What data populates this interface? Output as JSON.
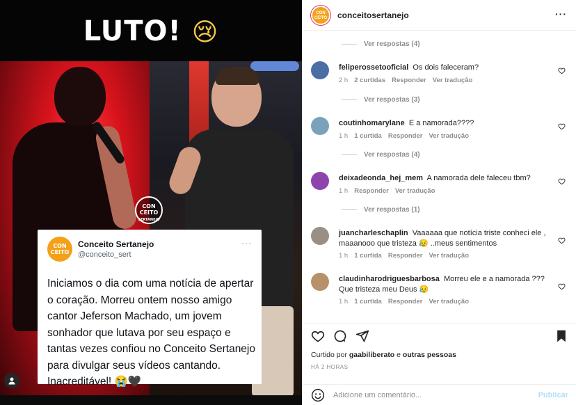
{
  "image": {
    "headline": "LUTO!",
    "headline_emoji": "😢",
    "watermark": "CON CEITO SERTANEJO",
    "tweet": {
      "avatar_text": "CON CEITO",
      "name": "Conceito Sertanejo",
      "handle": "@conceito_sert",
      "more": "···",
      "text": "Iniciamos o dia com uma notícia de apertar o coração. Morreu ontem nosso amigo cantor Jeferson Machado, um jovem sonhador que lutava por seu espaço e tantas vezes confiou no Conceito Sertanejo para divulgar seus vídeos cantando. Inacreditável! 😭🖤"
    }
  },
  "header": {
    "avatar_text": "CON CEITO",
    "username": "conceitosertanejo",
    "more": "···"
  },
  "comments": [
    {
      "type": "replies",
      "label": "Ver respostas (4)"
    },
    {
      "type": "comment",
      "username": "feliperossetooficial",
      "text": "Os dois faleceram?",
      "time": "2 h",
      "likes": "2 curtidas",
      "reply": "Responder",
      "translate": "Ver tradução",
      "avatar_color": "#4a6fa5"
    },
    {
      "type": "replies",
      "label": "Ver respostas (3)"
    },
    {
      "type": "comment",
      "username": "coutinhomarylane",
      "text": "E a namorada????",
      "time": "1 h",
      "likes": "1 curtida",
      "reply": "Responder",
      "translate": "Ver tradução",
      "avatar_color": "#7aa2b8"
    },
    {
      "type": "replies",
      "label": "Ver respostas (4)"
    },
    {
      "type": "comment",
      "username": "deixadeonda_hej_mem",
      "text": "A namorada dele faleceu tbm?",
      "time": "1 h",
      "likes": "",
      "reply": "Responder",
      "translate": "Ver tradução",
      "avatar_color": "#8e44ad"
    },
    {
      "type": "replies",
      "label": "Ver respostas (1)"
    },
    {
      "type": "comment",
      "username": "juancharleschaplin",
      "text": "Vaaaaaa que notícia triste conheci ele , maaanooo que tristeza 😥 ..meus sentimentos",
      "time": "1 h",
      "likes": "1 curtida",
      "reply": "Responder",
      "translate": "Ver tradução",
      "avatar_color": "#9a8f84"
    },
    {
      "type": "comment",
      "username": "claudinharodriguesbarbosa",
      "text": "Morreu ele e a namorada ??? Que tristeza meu Deus 😥",
      "time": "1 h",
      "likes": "1 curtida",
      "reply": "Responder",
      "translate": "Ver tradução",
      "avatar_color": "#b8906a"
    }
  ],
  "footer": {
    "liked_by_prefix": "Curtido por",
    "liked_by_user": "gaabiliberato",
    "liked_by_mid": "e",
    "liked_by_others": "outras pessoas",
    "time_ago": "HÁ 2 HORAS",
    "comment_placeholder": "Adicione um comentário...",
    "publish": "Publicar"
  },
  "colors": {
    "brand_orange": "#f4a11a",
    "publish_disabled": "#b2dffc",
    "muted_text": "#8e8e8e"
  }
}
